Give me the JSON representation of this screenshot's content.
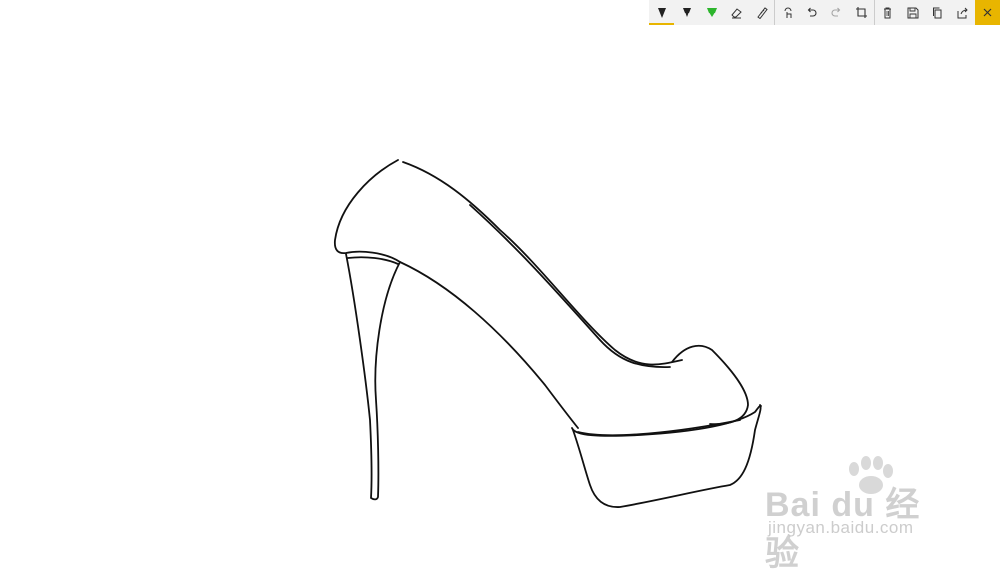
{
  "toolbar": {
    "buttons": [
      {
        "name": "ballpoint-pen",
        "icon": "pen-icon",
        "color": "#222222",
        "active": true
      },
      {
        "name": "pencil",
        "icon": "pencil-icon",
        "color": "#222222"
      },
      {
        "name": "highlighter",
        "icon": "highlighter-icon",
        "color": "#2db52d"
      },
      {
        "name": "eraser",
        "icon": "eraser-icon"
      },
      {
        "name": "ruler",
        "icon": "ruler-icon"
      },
      {
        "name": "touch-writing",
        "icon": "touch-writing-icon"
      },
      {
        "name": "undo",
        "icon": "undo-icon"
      },
      {
        "name": "redo",
        "icon": "redo-icon",
        "disabled": true
      },
      {
        "name": "crop",
        "icon": "crop-icon"
      },
      {
        "name": "clear-ink",
        "icon": "trash-icon"
      },
      {
        "name": "save",
        "icon": "save-icon"
      },
      {
        "name": "copy",
        "icon": "copy-icon"
      },
      {
        "name": "share",
        "icon": "share-icon"
      },
      {
        "name": "close",
        "icon": "close-icon"
      }
    ],
    "accent_color": "#e8b500"
  },
  "watermark": {
    "brand": "Bai du 经验",
    "url": "jingyan.baidu.com"
  }
}
